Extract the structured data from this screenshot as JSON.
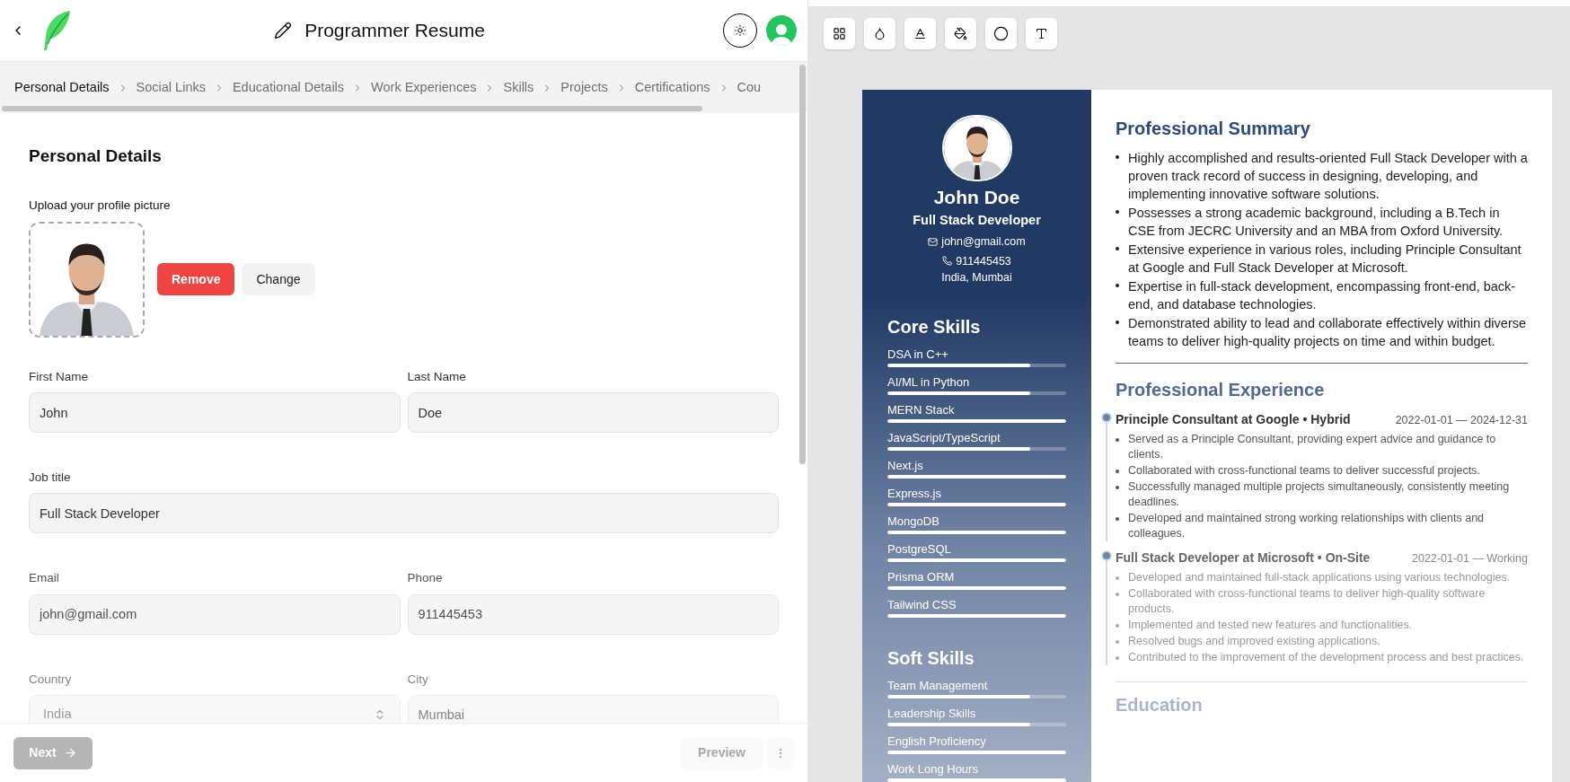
{
  "header": {
    "title": "Programmer Resume"
  },
  "steps": [
    {
      "label": "Personal Details",
      "selected": true
    },
    {
      "label": "Social Links",
      "selected": false
    },
    {
      "label": "Educational Details",
      "selected": false
    },
    {
      "label": "Work Experiences",
      "selected": false
    },
    {
      "label": "Skills",
      "selected": false
    },
    {
      "label": "Projects",
      "selected": false
    },
    {
      "label": "Certifications",
      "selected": false
    },
    {
      "label": "Cou",
      "selected": false
    }
  ],
  "form": {
    "heading": "Personal Details",
    "upload_label": "Upload your profile picture",
    "remove_button": "Remove",
    "change_button": "Change",
    "rows": [
      {
        "fields": [
          {
            "label": "First Name",
            "value": "John",
            "kind": "text"
          },
          {
            "label": "Last Name",
            "value": "Doe",
            "kind": "text"
          }
        ]
      },
      {
        "fields": [
          {
            "label": "Job title",
            "value": "Full Stack Developer",
            "kind": "text"
          }
        ]
      },
      {
        "fields": [
          {
            "label": "Email",
            "value": "john@gmail.com",
            "kind": "text"
          },
          {
            "label": "Phone",
            "value": "911445453",
            "kind": "text"
          }
        ]
      },
      {
        "fields": [
          {
            "label": "Country",
            "value": "India",
            "kind": "select"
          },
          {
            "label": "City",
            "value": "Mumbai",
            "kind": "text"
          }
        ]
      }
    ]
  },
  "footer": {
    "next": {
      "label": "Next",
      "disabled": true
    },
    "preview": {
      "label": "Preview",
      "disabled": true
    }
  },
  "resume": {
    "name": "John Doe",
    "job_title": "Full Stack Developer",
    "email": "john@gmail.com",
    "phone": "911445453",
    "location": "India, Mumbai",
    "core_skills_heading": "Core Skills",
    "core_skills": [
      {
        "name": "DSA in C++",
        "level": 0.8
      },
      {
        "name": "AI/ML in Python",
        "level": 0.8
      },
      {
        "name": "MERN Stack",
        "level": 1
      },
      {
        "name": "JavaScript/TypeScript",
        "level": 0.8
      },
      {
        "name": "Next.js",
        "level": 1
      },
      {
        "name": "Express.js",
        "level": 1
      },
      {
        "name": "MongoDB",
        "level": 1
      },
      {
        "name": "PostgreSQL",
        "level": 1
      },
      {
        "name": "Prisma ORM",
        "level": 1
      },
      {
        "name": "Tailwind CSS",
        "level": 1
      }
    ],
    "soft_skills_heading": "Soft Skills",
    "soft_skills": [
      {
        "name": "Team Management",
        "level": 0.8
      },
      {
        "name": "Leadership Skills",
        "level": 0.8
      },
      {
        "name": "English Proficiency",
        "level": 1
      },
      {
        "name": "Work Long Hours",
        "level": 1
      }
    ],
    "summary_heading": "Professional Summary",
    "summary": [
      "Highly accomplished and results-oriented Full Stack Developer with a proven track record of success in designing, developing, and implementing innovative software solutions.",
      "Possesses a strong academic background, including a B.Tech in CSE from JECRC University and an MBA from Oxford University.",
      "Extensive experience in various roles, including Principle Consultant at Google and Full Stack Developer at Microsoft.",
      "Expertise in full-stack development, encompassing front-end, back-end, and database technologies.",
      "Demonstrated ability to lead and collaborate effectively within diverse teams to deliver high-quality projects on time and within budget."
    ],
    "experience_heading": "Professional Experience",
    "experience": [
      {
        "title": "Principle Consultant at Google • Hybrid",
        "dates": "2022-01-01 — 2024-12-31",
        "points": [
          "Served as a Principle Consultant, providing expert advice and guidance to clients.",
          "Collaborated with cross-functional teams to deliver successful projects.",
          "Successfully managed multiple projects simultaneously, consistently meeting deadlines.",
          "Developed and maintained strong working relationships with clients and colleagues."
        ]
      },
      {
        "title": "Full Stack Developer at Microsoft • On-Site",
        "dates": "2022-01-01 — Working",
        "points": [
          "Developed and maintained full-stack applications using various technologies.",
          "Collaborated with cross-functional teams to deliver high-quality software products.",
          "Implemented and tested new features and functionalities.",
          "Resolved bugs and improved existing applications.",
          "Contributed to the improvement of the development process and best practices."
        ]
      }
    ],
    "education_heading": "Education"
  }
}
